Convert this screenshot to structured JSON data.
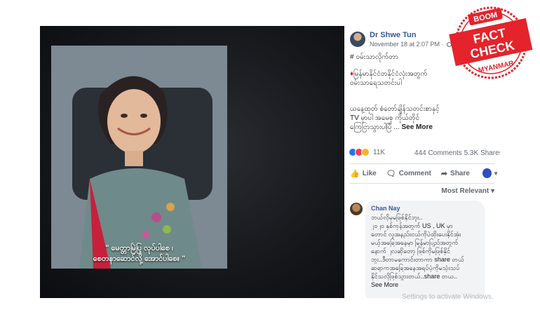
{
  "photo": {
    "caption_lines": [
      "\" မေတ္တာမြဲပြု လုပ်ပါစေ ၊",
      "စေတနာဆောင်လို့ အောင်ပါစေ။ \""
    ]
  },
  "post": {
    "author": "Dr Shwe Tun",
    "date": "November 18 at 2:07 PM · ",
    "hashtag": "# ဝမ်းသာလိုက်တာ",
    "body_line1": "မြန်မာနိုင်ငံတနိုင်ငံလုံးအတွက်",
    "body_line2": "ဝမ်းသာရေသတင်းပါ",
    "body_line3": "ယနေ့ထုတ် စံတော်ချိန်သတင်းစာနှင့်",
    "body_line4": "TV မှာပါ အမေစု ကိုယ်တိုင်",
    "body_line5": "ကြေငြာသွားပါပြီ ...",
    "see_more": "See More",
    "reactions_count": "11K",
    "comments_count": "444 Comments",
    "shares_count": "5.3K Shares",
    "actions": {
      "like": "Like",
      "comment": "Comment",
      "share": "Share"
    },
    "sort_label": "Most Relevant"
  },
  "comment": {
    "author": "Chan Nay",
    "lines": [
      "ဘယ်လိုမှမဖြစ်နိုင်ဘူး..",
      "၂၀၂၀ နှစ်ကုန်အတွက် US , UK မှာ",
      "တောင် လူအနည်းငယ်ကိုပဲထိုးပေးနိုင်အုံး",
      "မယ့်အခြေအနေမှာ မြန်မာပြည်အတွက်",
      "နောက် ၂လဆိုတော့ ဖြစ်ကိုမဖြစ်နိုင်",
      "ဘူး..ဒီတာမကောင်းတာကာ share တယ်",
      "ဆရာကအခြေအနေအရပ်ပုံကိုမသုံးသပ်",
      "နိုင်သလိုဖြစ်သွားတယ်..share တယ..",
      "See More"
    ]
  },
  "watermark": "Settings to activate Windows.",
  "stamp": {
    "brand": "BOOM",
    "title_line1": "FACT",
    "title_line2": "CHECK",
    "subtitle": "MYANMAR",
    "color": "#e4232b"
  }
}
